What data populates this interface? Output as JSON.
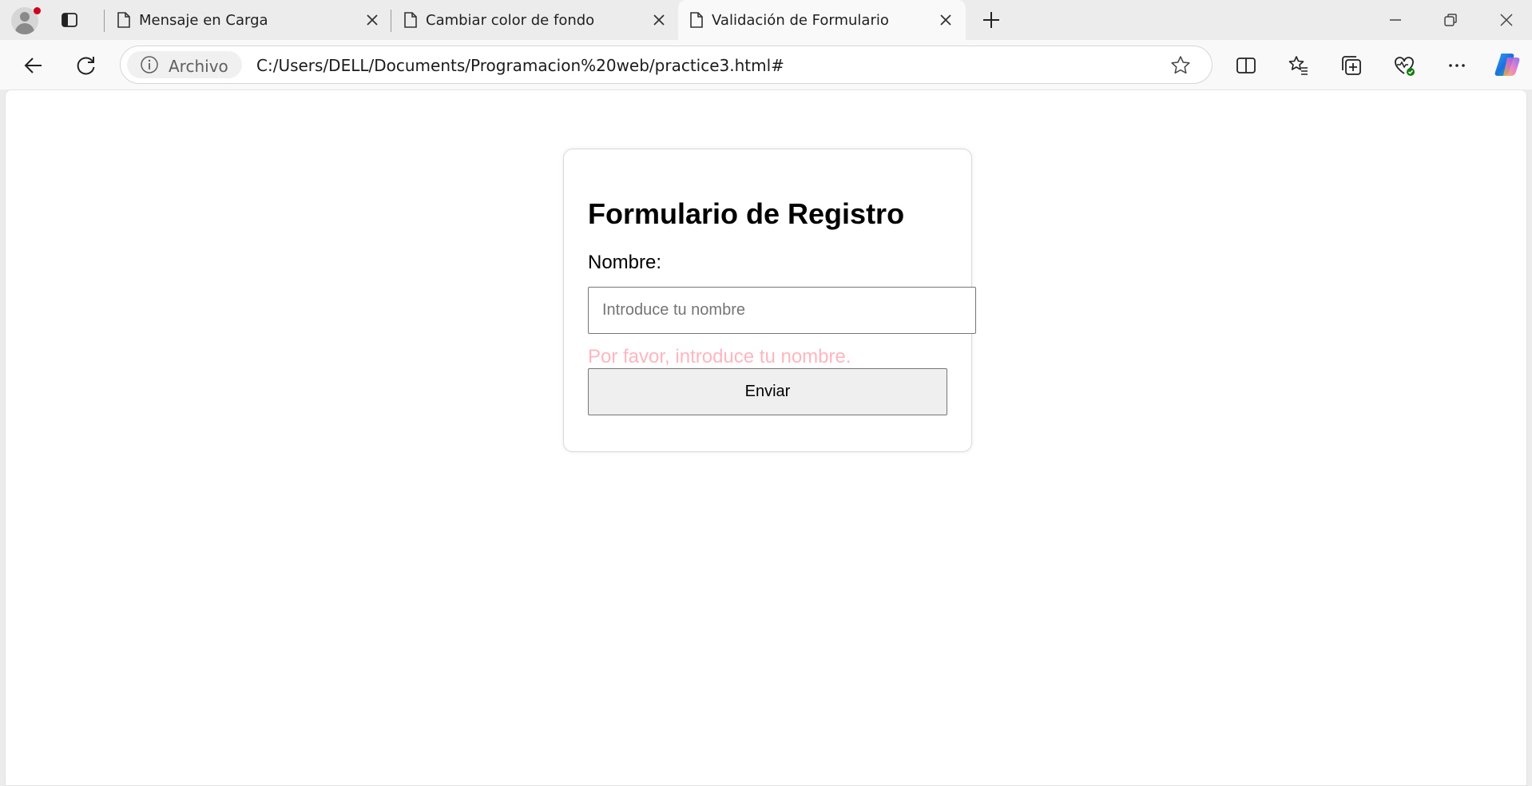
{
  "browser": {
    "tabs": [
      {
        "title": "Mensaje en Carga",
        "active": false
      },
      {
        "title": "Cambiar color de fondo",
        "active": false
      },
      {
        "title": "Validación de Formulario",
        "active": true
      }
    ],
    "site_info_label": "Archivo",
    "url": "C:/Users/DELL/Documents/Programacion%20web/practice3.html#",
    "icons": [
      "profile-icon",
      "tab-actions-icon",
      "page-icon",
      "close-icon",
      "new-tab-icon",
      "minimize-icon",
      "restore-icon",
      "window-close-icon",
      "back-icon",
      "refresh-icon",
      "info-icon",
      "favorite-star-icon",
      "split-screen-icon",
      "favorites-icon",
      "collections-icon",
      "browser-essentials-icon",
      "more-icon",
      "copilot-icon"
    ]
  },
  "form": {
    "title": "Formulario de Registro",
    "name_label": "Nombre:",
    "name_placeholder": "Introduce tu nombre",
    "name_value": "",
    "error_message": "Por favor, introduce tu nombre.",
    "submit_label": "Enviar"
  },
  "colors": {
    "error_text": "#ffb6c1",
    "profile_badge": "#d0021b"
  }
}
